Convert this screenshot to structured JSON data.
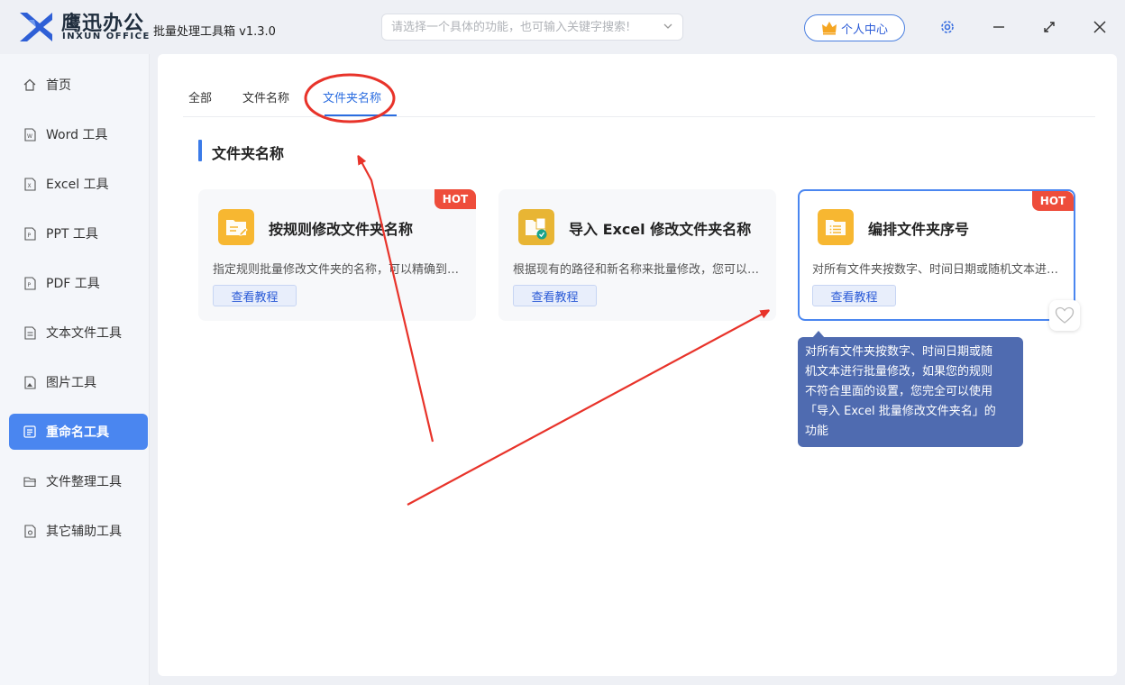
{
  "app": {
    "brand_cn": "鹰迅办公",
    "brand_en": "INXUN OFFICE",
    "title": "批量处理工具箱 v1.3.0"
  },
  "search": {
    "placeholder": "请选择一个具体的功能，也可输入关键字搜索!"
  },
  "header": {
    "user_center": "个人中心"
  },
  "sidebar": {
    "items": [
      {
        "label": "首页",
        "icon": "home-icon"
      },
      {
        "label": "Word 工具",
        "icon": "word-file-icon"
      },
      {
        "label": "Excel 工具",
        "icon": "excel-file-icon"
      },
      {
        "label": "PPT 工具",
        "icon": "ppt-file-icon"
      },
      {
        "label": "PDF 工具",
        "icon": "pdf-file-icon"
      },
      {
        "label": "文本文件工具",
        "icon": "text-file-icon"
      },
      {
        "label": "图片工具",
        "icon": "image-file-icon"
      },
      {
        "label": "重命名工具",
        "icon": "rename-icon",
        "active": true
      },
      {
        "label": "文件整理工具",
        "icon": "folder-icon"
      },
      {
        "label": "其它辅助工具",
        "icon": "tools-icon"
      }
    ]
  },
  "tabs": [
    {
      "label": "全部"
    },
    {
      "label": "文件名称"
    },
    {
      "label": "文件夹名称",
      "active": true
    }
  ],
  "section": {
    "title": "文件夹名称"
  },
  "cards": [
    {
      "title": "按规则修改文件夹名称",
      "desc": "指定规则批量修改文件夹的名称，可以精确到每一个字符的增删改操作",
      "tutorial": "查看教程",
      "badge": "HOT",
      "icon": "folder-edit-icon"
    },
    {
      "title": "导入 Excel 修改文件夹名称",
      "desc": "根据现有的路径和新名称来批量修改，您可以先导出再修改后导入",
      "tutorial": "查看教程",
      "icon": "folder-excel-icon"
    },
    {
      "title": "编排文件夹序号",
      "desc": "对所有文件夹按数字、时间日期或随机文本进行批量修改",
      "tutorial": "查看教程",
      "badge": "HOT",
      "icon": "folder-list-icon"
    }
  ],
  "tooltip": {
    "lines": [
      "对所有文件夹按数字、时间日期或随",
      "机文本进行批量修改，如果您的规则",
      "不符合里面的设置，您完全可以使用",
      "「导入 Excel 批量修改文件夹名」的",
      "功能"
    ]
  },
  "colors": {
    "accent": "#4a86f0",
    "hot": "#ee4d3b",
    "tooltip": "#4f6bb0",
    "annotation": "#e8332a"
  }
}
